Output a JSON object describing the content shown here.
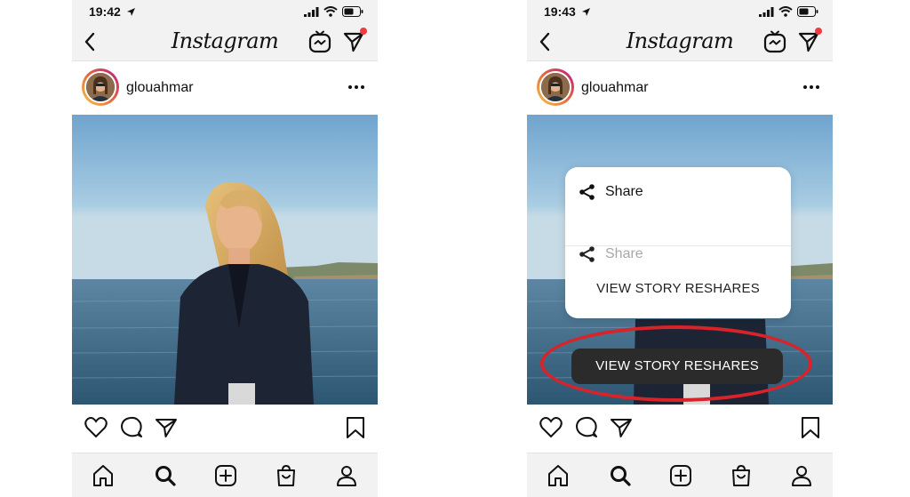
{
  "colors": {
    "accent_red": "#d8232a",
    "notification_dot": "#ed3b45",
    "toast_bg": "#2b2b2b"
  },
  "left_screen": {
    "status": {
      "time": "19:42"
    },
    "header": {
      "logo": "Instagram"
    },
    "post": {
      "username": "glouahmar"
    }
  },
  "right_screen": {
    "status": {
      "time": "19:43"
    },
    "header": {
      "logo": "Instagram"
    },
    "post": {
      "username": "glouahmar"
    },
    "menu": {
      "share_label": "Share",
      "share_label_faded": "Share",
      "reshares_label": "VIEW STORY RESHARES"
    },
    "toast": {
      "label": "VIEW STORY RESHARES"
    }
  },
  "icons": [
    "back-icon",
    "igtv-icon",
    "direct-message-icon",
    "more-icon",
    "heart-icon",
    "comment-icon",
    "send-icon",
    "bookmark-icon",
    "home-icon",
    "search-icon",
    "new-post-icon",
    "shop-icon",
    "profile-icon",
    "share-icon",
    "location-arrow-icon",
    "signal-icon",
    "wifi-icon",
    "battery-icon"
  ]
}
